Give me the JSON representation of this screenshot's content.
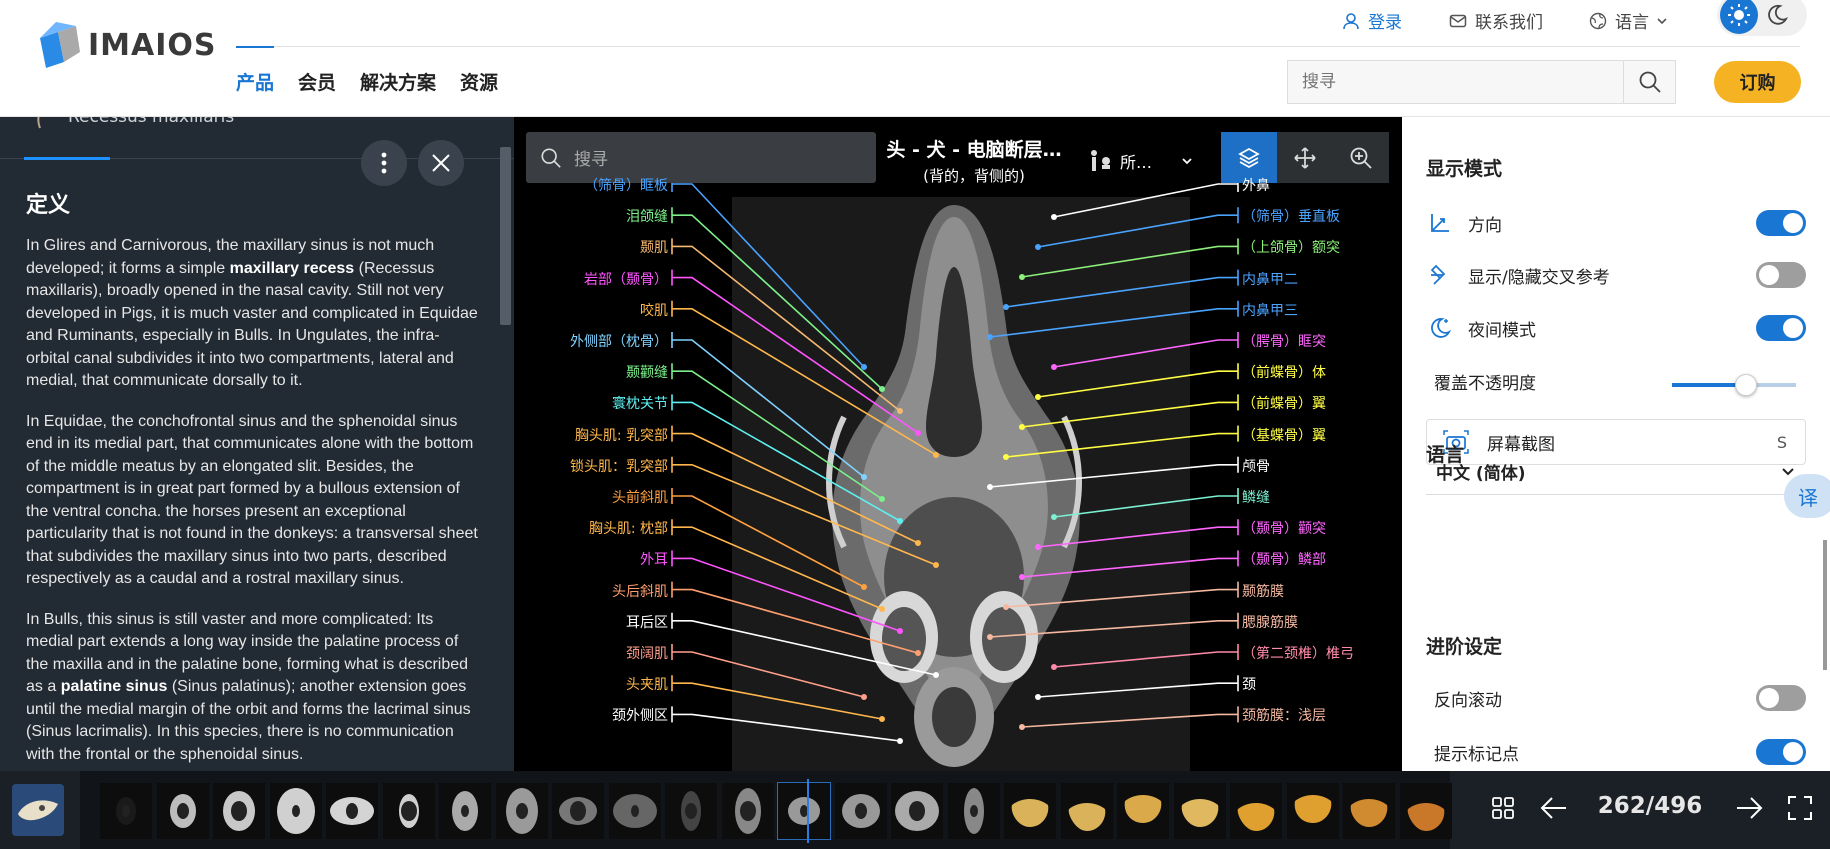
{
  "header": {
    "logo_text": "IMAIOS",
    "login": "登录",
    "contact": "联系我们",
    "language": "语言",
    "nav": [
      "产品",
      "会员",
      "解决方案",
      "资源"
    ],
    "search_placeholder": "搜寻",
    "subscribe": "订购",
    "brand_color": "#1976d2",
    "subscribe_color": "#f5b323"
  },
  "left_panel": {
    "tab_title": "Recessus maxillaris",
    "heading": "定义",
    "p1_a": "In Glires and Carnivorous, the maxillary sinus is not much developed; it forms a simple ",
    "p1_b": "maxillary recess",
    "p1_c": " (Recessus maxillaris), broadly opened in the nasal cavity. Still not very developed in Pigs, it is much vaster and complicated in Equidae and Ruminants, especially in Bulls. In Ungulates, the infra-orbital canal subdivides it into two compartments, lateral and medial, that communicate dorsally to it.",
    "p2": "In Equidae, the conchofrontal sinus and the sphenoidal sinus end in its medial part, that communicates alone with the bottom of the middle meatus by an elongated slit. Besides, the compartment is in great part formed by a bullous extension of the ventral concha. the horses present an exceptional particularity that is not found in the donkeys: a transversal sheet that subdivides the maxillary sinus into two parts, described respectively as a caudal and a rostral maxillary sinus.",
    "p3_a": "In Bulls, this sinus is still vaster and more complicated: Its medial part extends a long way inside the palatine process of the maxilla and in the palatine bone, forming what is described as a ",
    "p3_b": "palatine sinus",
    "p3_c": " (Sinus palatinus); another extension goes until the medial margin of the orbit and forms the lacrimal sinus (Sinus lacrimalis). In this species, there is no communication with the frontal or the sphenoidal sinus."
  },
  "viewer": {
    "search_placeholder": "搜寻",
    "title": "头 - 犬 - 电脑断层…",
    "subtitle": "(背的，背侧的)",
    "series_label": "所…",
    "left_labels": [
      {
        "text": "（筛骨）眶板",
        "color": "#4aa3ff"
      },
      {
        "text": "泪颌缝",
        "color": "#7cf08a"
      },
      {
        "text": "颞肌",
        "color": "#f5b870"
      },
      {
        "text": "岩部（颞骨）",
        "color": "#ff55ff"
      },
      {
        "text": "咬肌",
        "color": "#ffb74d"
      },
      {
        "text": "外侧部（枕骨）",
        "color": "#7fd3ff"
      },
      {
        "text": "颞颧缝",
        "color": "#7cf08a"
      },
      {
        "text": "寰枕关节",
        "color": "#5ef0f0"
      },
      {
        "text": "胸头肌: 乳突部",
        "color": "#ffb74d"
      },
      {
        "text": "锁头肌：乳突部",
        "color": "#ffb74d"
      },
      {
        "text": "头前斜肌",
        "color": "#ffa040"
      },
      {
        "text": "胸头肌: 枕部",
        "color": "#ffb74d"
      },
      {
        "text": "外耳",
        "color": "#ff55ff"
      },
      {
        "text": "头后斜肌",
        "color": "#ff9e6e"
      },
      {
        "text": "耳后区",
        "color": "#ffffff"
      },
      {
        "text": "颈阔肌",
        "color": "#ff9e8a"
      },
      {
        "text": "头夹肌",
        "color": "#ffb74d"
      },
      {
        "text": "颈外侧区",
        "color": "#ffffff"
      }
    ],
    "right_labels": [
      {
        "text": "外鼻",
        "color": "#ffffff"
      },
      {
        "text": "（筛骨）垂直板",
        "color": "#4aa3ff"
      },
      {
        "text": "（上颌骨）额突",
        "color": "#8cf07a"
      },
      {
        "text": "内鼻甲二",
        "color": "#4aa3ff"
      },
      {
        "text": "内鼻甲三",
        "color": "#4aa3ff"
      },
      {
        "text": "（腭骨）眶突",
        "color": "#ff66ff"
      },
      {
        "text": "（前蝶骨）体",
        "color": "#ffff44"
      },
      {
        "text": "（前蝶骨）翼",
        "color": "#ffff44"
      },
      {
        "text": "（基蝶骨）翼",
        "color": "#ffff44"
      },
      {
        "text": "颅骨",
        "color": "#ffffff"
      },
      {
        "text": "鳞缝",
        "color": "#7cf0d0"
      },
      {
        "text": "（颞骨）颧突",
        "color": "#ff66ff"
      },
      {
        "text": "（颞骨）鳞部",
        "color": "#ff66ff"
      },
      {
        "text": "颞筋膜",
        "color": "#f5b8a0"
      },
      {
        "text": "腮腺筋膜",
        "color": "#f5b8a0"
      },
      {
        "text": "（第二颈椎）椎弓",
        "color": "#ff8aa8"
      },
      {
        "text": "颈",
        "color": "#ffffff"
      },
      {
        "text": "颈筋膜：浅层",
        "color": "#f5b8a0"
      }
    ]
  },
  "right_panel": {
    "display_mode": "显示模式",
    "orientation": "方向",
    "cross_ref": "显示/隐藏交叉参考",
    "night_mode": "夜间模式",
    "overlay_opacity": "覆盖不透明度",
    "opacity_value": 0.6,
    "screenshot": "屏幕截图",
    "screenshot_key": "S",
    "language_heading": "语言",
    "language_value": "中文 (简体)",
    "advanced": "进阶设定",
    "reverse_scroll": "反向滚动",
    "hint_markers": "提示标记点",
    "toggles": {
      "orientation": true,
      "cross_ref": false,
      "night_mode": true,
      "reverse_scroll": false,
      "hint_markers": true
    },
    "translate_icon": "译"
  },
  "bottom": {
    "page": "262/496"
  }
}
